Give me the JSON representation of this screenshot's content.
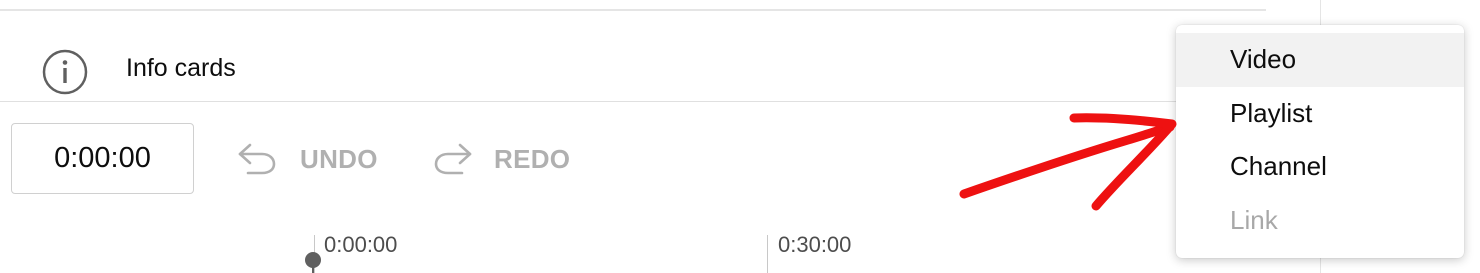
{
  "info_cards": {
    "label": "Info cards",
    "icon": "info-icon"
  },
  "toolbar": {
    "time_value": "0:00:00",
    "undo_label": "UNDO",
    "redo_label": "REDO",
    "undo_icon": "undo-icon",
    "redo_icon": "redo-icon"
  },
  "timeline": {
    "ticks": [
      {
        "label": "0:00:00"
      },
      {
        "label": "0:30:00"
      }
    ]
  },
  "menu": {
    "items": [
      {
        "label": "Video",
        "state": "hovered"
      },
      {
        "label": "Playlist",
        "state": "normal"
      },
      {
        "label": "Channel",
        "state": "normal"
      },
      {
        "label": "Link",
        "state": "disabled"
      }
    ]
  },
  "colors": {
    "disabled_text": "#b0b0b0",
    "annotation": "#ee1111",
    "hover_bg": "#f2f2f2"
  }
}
